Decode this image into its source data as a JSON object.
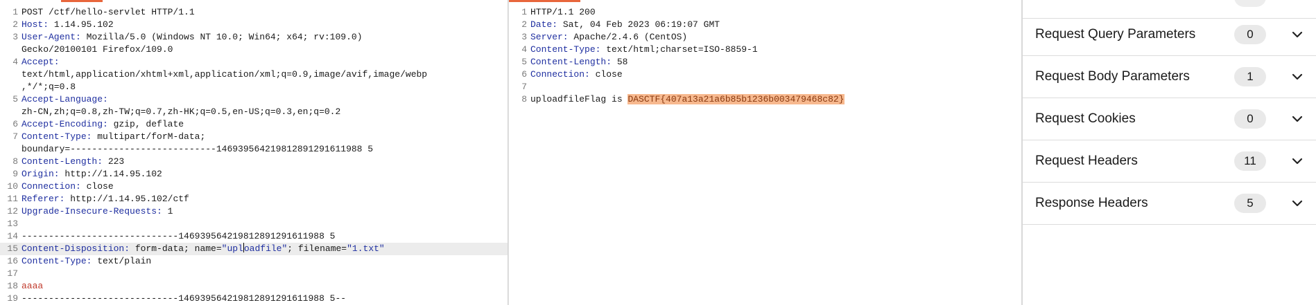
{
  "request": {
    "lines": [
      {
        "n": "1",
        "parts": [
          {
            "t": "POST /ctf/hello-servlet HTTP/1.1"
          }
        ]
      },
      {
        "n": "2",
        "parts": [
          {
            "t": "Host:",
            "c": "hk"
          },
          {
            "t": " 1.14.95.102"
          }
        ]
      },
      {
        "n": "3",
        "parts": [
          {
            "t": "User-Agent:",
            "c": "hk"
          },
          {
            "t": " Mozilla/5.0 (Windows NT 10.0; Win64; x64; rv:109.0)"
          }
        ]
      },
      {
        "n": "",
        "cont": true,
        "parts": [
          {
            "t": "Gecko/20100101 Firefox/109.0"
          }
        ]
      },
      {
        "n": "4",
        "parts": [
          {
            "t": "Accept:",
            "c": "hk"
          }
        ]
      },
      {
        "n": "",
        "cont": true,
        "parts": [
          {
            "t": "text/html,application/xhtml+xml,application/xml;q=0.9,image/avif,image/webp"
          }
        ]
      },
      {
        "n": "",
        "cont": true,
        "parts": [
          {
            "t": ",*/*;q=0.8"
          }
        ]
      },
      {
        "n": "5",
        "parts": [
          {
            "t": "Accept-Language:",
            "c": "hk"
          }
        ]
      },
      {
        "n": "",
        "cont": true,
        "parts": [
          {
            "t": "zh-CN,zh;q=0.8,zh-TW;q=0.7,zh-HK;q=0.5,en-US;q=0.3,en;q=0.2"
          }
        ]
      },
      {
        "n": "6",
        "parts": [
          {
            "t": "Accept-Encoding:",
            "c": "hk"
          },
          {
            "t": " gzip, deflate"
          }
        ]
      },
      {
        "n": "7",
        "parts": [
          {
            "t": "Content-Type:",
            "c": "hk"
          },
          {
            "t": " multipart/forM-data;"
          }
        ]
      },
      {
        "n": "",
        "cont": true,
        "parts": [
          {
            "t": "boundary=---------------------------146939564219812891291611988 5"
          }
        ]
      },
      {
        "n": "8",
        "parts": [
          {
            "t": "Content-Length:",
            "c": "hk"
          },
          {
            "t": " 223"
          }
        ]
      },
      {
        "n": "9",
        "parts": [
          {
            "t": "Origin:",
            "c": "hk"
          },
          {
            "t": " http://1.14.95.102"
          }
        ]
      },
      {
        "n": "10",
        "parts": [
          {
            "t": "Connection:",
            "c": "hk"
          },
          {
            "t": " close"
          }
        ]
      },
      {
        "n": "11",
        "parts": [
          {
            "t": "Referer:",
            "c": "hk"
          },
          {
            "t": " http://1.14.95.102/ctf"
          }
        ]
      },
      {
        "n": "12",
        "parts": [
          {
            "t": "Upgrade-Insecure-Requests:",
            "c": "hk"
          },
          {
            "t": " 1"
          }
        ]
      },
      {
        "n": "13",
        "parts": [
          {
            "t": ""
          }
        ]
      },
      {
        "n": "14",
        "parts": [
          {
            "t": "-----------------------------146939564219812891291611988 5"
          }
        ]
      },
      {
        "n": "15",
        "hl": true,
        "parts": [
          {
            "t": "Content-Disposition:",
            "c": "hk"
          },
          {
            "t": " form-data; name="
          },
          {
            "t": "\"upl",
            "c": "str"
          },
          {
            "caret": true
          },
          {
            "t": "oadfile\"",
            "c": "str"
          },
          {
            "t": "; filename="
          },
          {
            "t": "\"1.txt\"",
            "c": "str"
          }
        ]
      },
      {
        "n": "16",
        "parts": [
          {
            "t": "Content-Type:",
            "c": "hk"
          },
          {
            "t": " text/plain"
          }
        ]
      },
      {
        "n": "17",
        "parts": [
          {
            "t": ""
          }
        ]
      },
      {
        "n": "18",
        "parts": [
          {
            "t": "aaaa",
            "c": "red"
          }
        ]
      },
      {
        "n": "19",
        "parts": [
          {
            "t": "-----------------------------146939564219812891291611988 5--"
          }
        ]
      }
    ]
  },
  "response": {
    "lines": [
      {
        "n": "1",
        "parts": [
          {
            "t": "HTTP/1.1 200"
          }
        ]
      },
      {
        "n": "2",
        "parts": [
          {
            "t": "Date:",
            "c": "hk"
          },
          {
            "t": " Sat, 04 Feb 2023 06:19:07 GMT"
          }
        ]
      },
      {
        "n": "3",
        "parts": [
          {
            "t": "Server:",
            "c": "hk"
          },
          {
            "t": " Apache/2.4.6 (CentOS)"
          }
        ]
      },
      {
        "n": "4",
        "parts": [
          {
            "t": "Content-Type:",
            "c": "hk"
          },
          {
            "t": " text/html;charset=ISO-8859-1"
          }
        ]
      },
      {
        "n": "5",
        "parts": [
          {
            "t": "Content-Length:",
            "c": "hk"
          },
          {
            "t": " 58"
          }
        ]
      },
      {
        "n": "6",
        "parts": [
          {
            "t": "Connection:",
            "c": "hk"
          },
          {
            "t": " close"
          }
        ]
      },
      {
        "n": "7",
        "parts": [
          {
            "t": ""
          }
        ]
      },
      {
        "n": "8",
        "parts": [
          {
            "t": "uploadfileFlag is "
          },
          {
            "t": "DASCTF{407a13a21a6b85b1236b003479468c82}",
            "c": "flag"
          }
        ]
      }
    ]
  },
  "inspector": {
    "sections": [
      {
        "label": "Request Query Parameters",
        "count": "0",
        "icon": "chevron-down-icon"
      },
      {
        "label": "Request Body Parameters",
        "count": "1",
        "icon": "chevron-down-icon"
      },
      {
        "label": "Request Cookies",
        "count": "0",
        "icon": "chevron-down-icon"
      },
      {
        "label": "Request Headers",
        "count": "11",
        "icon": "chevron-down-icon"
      },
      {
        "label": "Response Headers",
        "count": "5",
        "icon": "chevron-down-icon"
      }
    ]
  },
  "colors": {
    "accent": "#e8663c",
    "header_key": "#1f2fa0",
    "flag_bg": "#f7b98f",
    "body_text": "#c0392b"
  }
}
